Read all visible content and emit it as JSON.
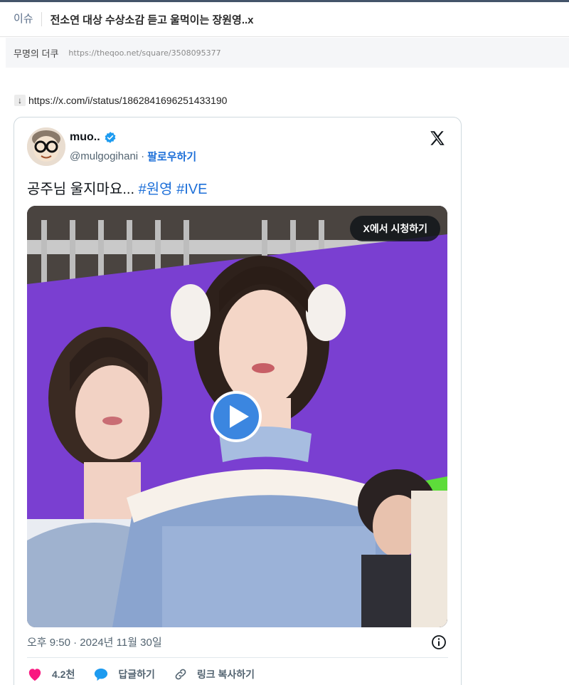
{
  "post": {
    "category": "이슈",
    "title": "전소연 대상 수상소감 듣고 울먹이는 장원영..x",
    "author": "무명의 더쿠",
    "url": "https://theqoo.net/square/3508095377"
  },
  "source": {
    "arrow": "↓",
    "link": "https://x.com/i/status/1862841696251433190"
  },
  "tweet": {
    "display_name": "muo..",
    "handle": "@mulgogihani",
    "separator": "·",
    "follow_label": "팔로우하기",
    "text": "공주님 울지마요...",
    "hashtags": [
      "#원영",
      "#IVE"
    ],
    "watch_on_x_label": "X에서 시청하기",
    "timestamp": "오후 9:50 · 2024년 11월 30일",
    "likes": "4.2천",
    "reply_label": "답글하기",
    "copy_link_label": "링크 복사하기"
  },
  "icons": {
    "verified": "verified-badge-icon",
    "x_logo": "x-logo-icon",
    "play": "play-icon",
    "info": "info-icon",
    "heart": "heart-icon",
    "reply": "speech-bubble-icon",
    "link": "link-icon"
  },
  "colors": {
    "accent_blue": "#1d6fd8",
    "heart_pink": "#f91880",
    "reply_blue": "#1d9bf0",
    "header_rule": "#44546a",
    "stage_purple": "#7a3fd1"
  }
}
